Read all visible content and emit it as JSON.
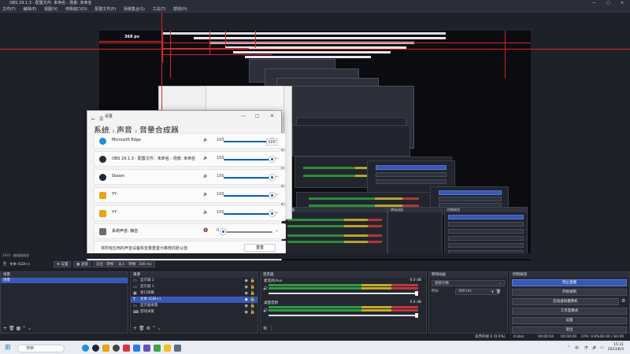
{
  "window": {
    "title": "OBS 29.1.3 - 配置文件: 未命名 - 场景: 未命名"
  },
  "menu": [
    "文件(F)",
    "编辑(E)",
    "视图(V)",
    "停靠窗口(D)",
    "配置文件(P)",
    "场景集合(S)",
    "工具(T)",
    "帮助(H)"
  ],
  "preview": {
    "measure_label": "368 px"
  },
  "settings_window": {
    "title": "设置",
    "breadcrumb": [
      "系统",
      "声音",
      "音量合成器"
    ],
    "tooltip": "100",
    "apps": [
      {
        "name": "Microsoft Edge",
        "volume": 100,
        "icon_color": "#1f8fd8",
        "icon": "edge-icon"
      },
      {
        "name": "OBS 29.1.3 - 配置文件：未命名 - 场景: 未命名",
        "volume": 100,
        "icon_color": "#2b2b2b",
        "icon": "obs-icon"
      },
      {
        "name": "Steam",
        "volume": 100,
        "icon_color": "#1b2838",
        "icon": "steam-icon"
      },
      {
        "name": "YY",
        "volume": 100,
        "icon_color": "#e8a317",
        "icon": "yy-icon"
      },
      {
        "name": "YY",
        "volume": 100,
        "icon_color": "#e8a317",
        "icon": "yy-icon"
      },
      {
        "name": "系统声音: 静音",
        "volume": 0,
        "icon_color": "#6b6b6b",
        "icon": "system-sounds-icon",
        "short": "系统声音 · 静音"
      }
    ],
    "reset_text": "将所有应用的声音设备和音量重置为推荐的默认值",
    "reset_button": "重置"
  },
  "status_mini": "1920 · 编辑器缩放",
  "controls": {
    "source_label": "文本 (GDI+)",
    "properties": "设置",
    "filters": "滤镜",
    "transition_left": "淡出 · 转换",
    "transition_right": "淡入 · 转换",
    "duration": "300 ms"
  },
  "panels": {
    "scenes": {
      "title": "场景",
      "items": [
        "场景"
      ]
    },
    "sources": {
      "title": "来源",
      "items": [
        {
          "name": "显示器 2",
          "icon": "monitor-icon"
        },
        {
          "name": "显示器 1",
          "icon": "monitor-icon"
        },
        {
          "name": "窗口采集",
          "icon": "window-icon"
        },
        {
          "name": "文本 (GDI+)",
          "icon": "text-icon",
          "selected": true
        },
        {
          "name": "显示器采集",
          "icon": "monitor-icon"
        },
        {
          "name": "游戏采集",
          "icon": "gamepad-icon"
        }
      ]
    },
    "mixer": {
      "title": "混音器",
      "channels": [
        {
          "name": "麦克风/Aux",
          "db": "0.0 dB"
        },
        {
          "name": "桌面音频",
          "db": "0.0 dB"
        }
      ]
    },
    "transitions": {
      "title": "转场动画",
      "selected": "直接切换",
      "duration_label": "时长",
      "duration": "300 ms"
    },
    "controls": {
      "title": "控制按钮",
      "buttons": [
        "停止直播",
        "开始录制",
        "启动虚拟摄像机",
        "工作室模式",
        "设置",
        "退出"
      ]
    }
  },
  "statusbar": {
    "dropped": "丢弃的帧 0 (0.0%)",
    "recording": "00:00:00",
    "kbps": "0 kb/s",
    "stream_time": "00:00:04",
    "cpu": "CPU: 0.6%",
    "fps": "60.00 / 60.00 FPS"
  },
  "taskbar": {
    "search": "搜索",
    "time": "15:31",
    "date": "2023/8/3",
    "lang": "中"
  }
}
